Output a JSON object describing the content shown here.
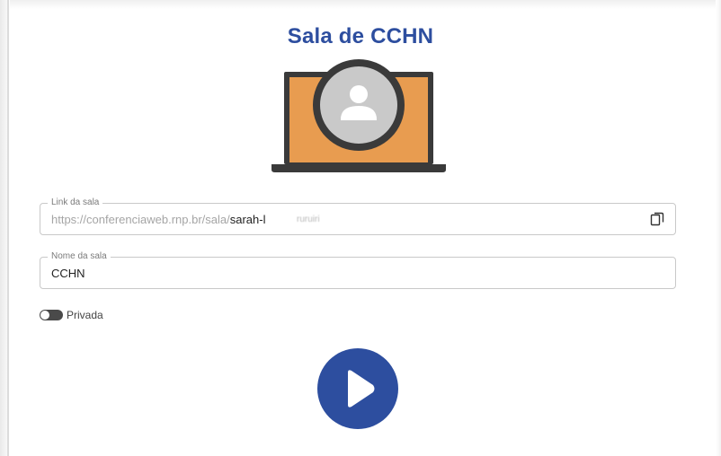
{
  "room": {
    "title": "Sala de CCHN"
  },
  "link_field": {
    "legend": "Link da sala",
    "prefix": "https://conferenciaweb.rnp.br/sala/",
    "slug": "sarah-l",
    "obscured_suffix": "ruruiri"
  },
  "name_field": {
    "legend": "Nome da sala",
    "value": "CCHN"
  },
  "private_toggle": {
    "label": "Privada",
    "enabled": false
  },
  "icons": {
    "illustration": "laptop-user-avatar-icon",
    "copy": "copy-icon",
    "play": "play-icon",
    "toggle": "toggle-switch"
  },
  "colors": {
    "primary": "#2d4e9f",
    "laptop_screen": "#e89c50",
    "laptop_frame": "#3a3a3a",
    "avatar_bg": "#c9c9c9",
    "avatar_fg": "#ffffff"
  }
}
